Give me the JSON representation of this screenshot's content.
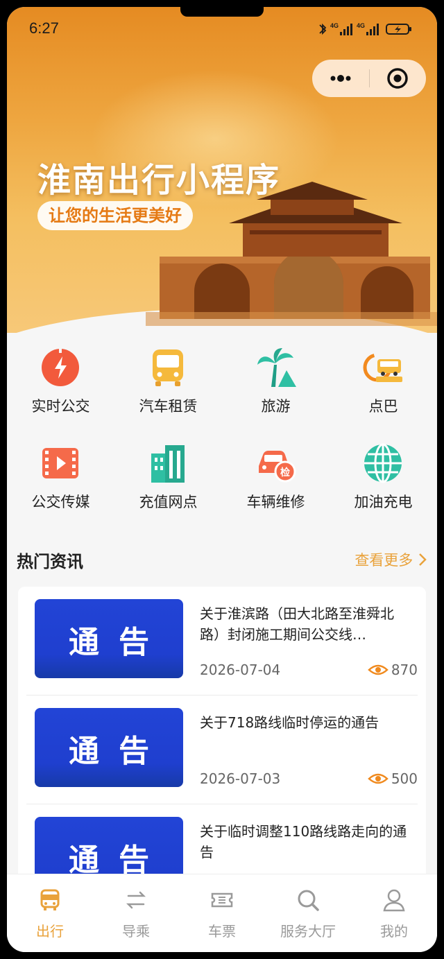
{
  "status": {
    "time": "6:27"
  },
  "banner": {
    "title": "淮南出行小程序",
    "subtitle": "让您的生活更美好"
  },
  "services": [
    {
      "label": "实时公交",
      "icon": "realtime-bus-icon",
      "color": "#f25a3c"
    },
    {
      "label": "汽车租赁",
      "icon": "bus-icon",
      "color": "#f5b93c"
    },
    {
      "label": "旅游",
      "icon": "palm-tree-icon",
      "color": "#2fbfa3"
    },
    {
      "label": "点巴",
      "icon": "minibus-badge-icon",
      "color": "#f28a1e"
    },
    {
      "label": "公交传媒",
      "icon": "video-icon",
      "color": "#f56a4a"
    },
    {
      "label": "充值网点",
      "icon": "building-icon",
      "color": "#2fbfa3"
    },
    {
      "label": "车辆维修",
      "icon": "car-inspection-icon",
      "color": "#f56a4a"
    },
    {
      "label": "加油充电",
      "icon": "globe-icon",
      "color": "#2fbfa3"
    }
  ],
  "news": {
    "heading": "热门资讯",
    "more": "查看更多",
    "thumb_text": "通告",
    "items": [
      {
        "title": "关于淮滨路（田大北路至淮舜北路）封闭施工期间公交线…",
        "date": "2026-07-04",
        "views": "870"
      },
      {
        "title": "关于718路线临时停运的通告",
        "date": "2026-07-03",
        "views": "500"
      },
      {
        "title": "关于临时调整110路线路走向的通告",
        "date": "",
        "views": ""
      }
    ]
  },
  "tabs": [
    {
      "label": "出行",
      "icon": "bus-tab-icon",
      "active": true
    },
    {
      "label": "导乘",
      "icon": "transfer-icon",
      "active": false
    },
    {
      "label": "车票",
      "icon": "ticket-icon",
      "active": false
    },
    {
      "label": "服务大厅",
      "icon": "search-icon",
      "active": false
    },
    {
      "label": "我的",
      "icon": "user-icon",
      "active": false
    }
  ],
  "colors": {
    "accent": "#e9a23b",
    "notice_blue": "#2244d6"
  }
}
